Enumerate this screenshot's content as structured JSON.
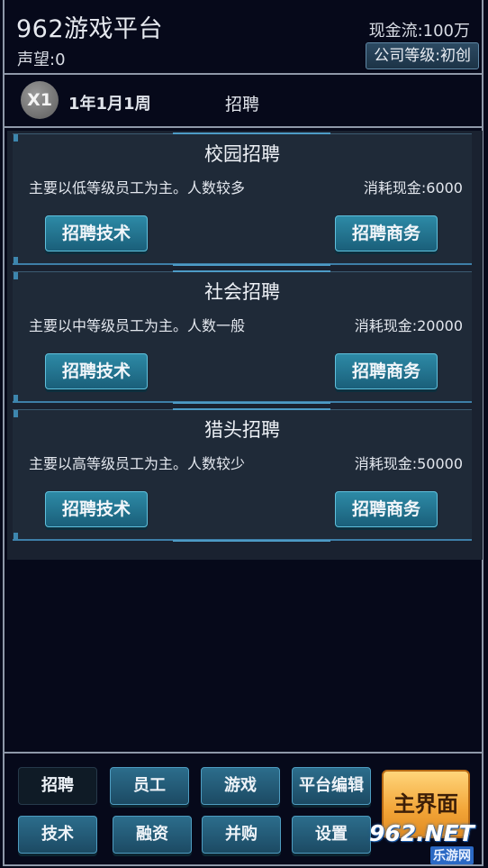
{
  "header": {
    "title": "962游戏平台",
    "reputation": "声望:0",
    "cash": "现金流:100万",
    "company_level": "公司等级:初创"
  },
  "status_bar": {
    "speed": "X1",
    "date": "1年1月1周",
    "screen_title": "招聘"
  },
  "recruit_cards": [
    {
      "title": "校园招聘",
      "desc": "主要以低等级员工为主。人数较多",
      "cost": "消耗现金:6000",
      "tech_button": "招聘技术",
      "biz_button": "招聘商务"
    },
    {
      "title": "社会招聘",
      "desc": "主要以中等级员工为主。人数一般",
      "cost": "消耗现金:20000",
      "tech_button": "招聘技术",
      "biz_button": "招聘商务"
    },
    {
      "title": "猎头招聘",
      "desc": "主要以高等级员工为主。人数较少",
      "cost": "消耗现金:50000",
      "tech_button": "招聘技术",
      "biz_button": "招聘商务"
    }
  ],
  "bottom_nav": {
    "recruit": "招聘",
    "staff": "员工",
    "games": "游戏",
    "platform_edit": "平台编辑",
    "tech": "技术",
    "finance": "融资",
    "acquire": "并购",
    "settings": "设置",
    "main": "主界面"
  },
  "watermark": {
    "main": "962.NET",
    "sub": "乐游网"
  },
  "colors": {
    "background": "#06091a",
    "card": "#1f2a38",
    "button": "#2d8aa6",
    "main_button": "#f2a437"
  }
}
